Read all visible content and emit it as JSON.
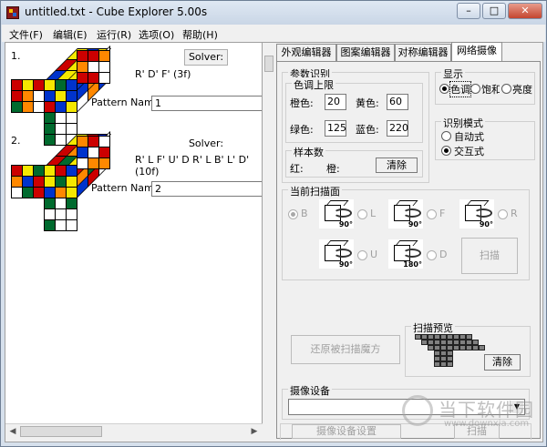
{
  "window": {
    "title": "untitled.txt - Cube Explorer 5.00s",
    "controls": [
      "minimize-icon",
      "maximize-icon",
      "close-icon"
    ]
  },
  "menu": [
    "文件(F)",
    "编辑(E)",
    "运行(R)",
    "选项(O)",
    "帮助(H)"
  ],
  "solutions": [
    {
      "index": "1.",
      "solver_label": "Solver:",
      "moves": "R' D' F' (3f)",
      "pattern_label": "Pattern Name:",
      "pattern_value": "1"
    },
    {
      "index": "2.",
      "solver_label": "Solver:",
      "moves": "R' L F' U' D R' L B' L' D' (10f)",
      "pattern_label": "Pattern Name:",
      "pattern_value": "2"
    }
  ],
  "tabs": [
    "外观编辑器",
    "图案编辑器",
    "对称编辑器",
    "网络摄像"
  ],
  "active_tab": "网络摄像",
  "params": {
    "title": "参数识别",
    "hue_group": {
      "title": "色调上限",
      "orange_label": "橙色:",
      "orange_value": "20",
      "yellow_label": "黄色:",
      "yellow_value": "60",
      "green_label": "绿色:",
      "green_value": "125",
      "blue_label": "蓝色:",
      "blue_value": "220"
    },
    "samples": {
      "title": "样本数",
      "red_label": "红:",
      "orange_label": "橙:",
      "clear_button": "清除"
    }
  },
  "display": {
    "title": "显示",
    "options": [
      "色调",
      "饱和",
      "亮度"
    ],
    "selected": "色调"
  },
  "recognition": {
    "title": "识别模式",
    "options": [
      "自动式",
      "交互式"
    ],
    "selected": "交互式"
  },
  "scan_face": {
    "title": "当前扫描面",
    "faces": [
      "B",
      "L",
      "F",
      "R",
      "U",
      "D"
    ],
    "selected": "B",
    "rotations": [
      "90°",
      "90°",
      "90°",
      "90°",
      "180°"
    ],
    "scan_button": "扫描"
  },
  "restore_button": "还原被扫描魔方",
  "scan_preview": {
    "title": "扫描预览",
    "clear_button": "清除"
  },
  "camera": {
    "title": "摄像设备",
    "selected": "",
    "settings_button": "摄像设备设置",
    "scan_button": "扫描"
  },
  "watermark": {
    "text": "当下软件园",
    "url": "www.downxia.com"
  },
  "colors": {
    "red": "#cc0000",
    "orange": "#ff8800",
    "yellow": "#f5e800",
    "green": "#006a2e",
    "blue": "#0033cc",
    "white": "#ffffff",
    "accent": "#3399ff"
  }
}
